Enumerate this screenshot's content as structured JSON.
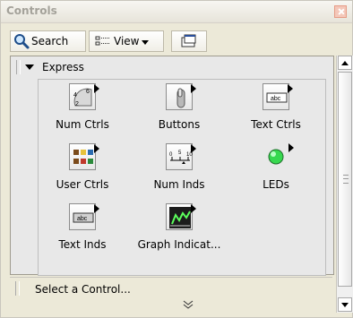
{
  "window": {
    "title": "Controls"
  },
  "toolbar": {
    "search_label": "Search",
    "view_label": "View"
  },
  "palette": {
    "category": "Express"
  },
  "items": [
    "Num Ctrls",
    "Buttons",
    "Text Ctrls",
    "User Ctrls",
    "Num Inds",
    "LEDs",
    "Text Inds",
    "Graph Indicat..."
  ],
  "bottom": {
    "select_label": "Select a Control..."
  }
}
